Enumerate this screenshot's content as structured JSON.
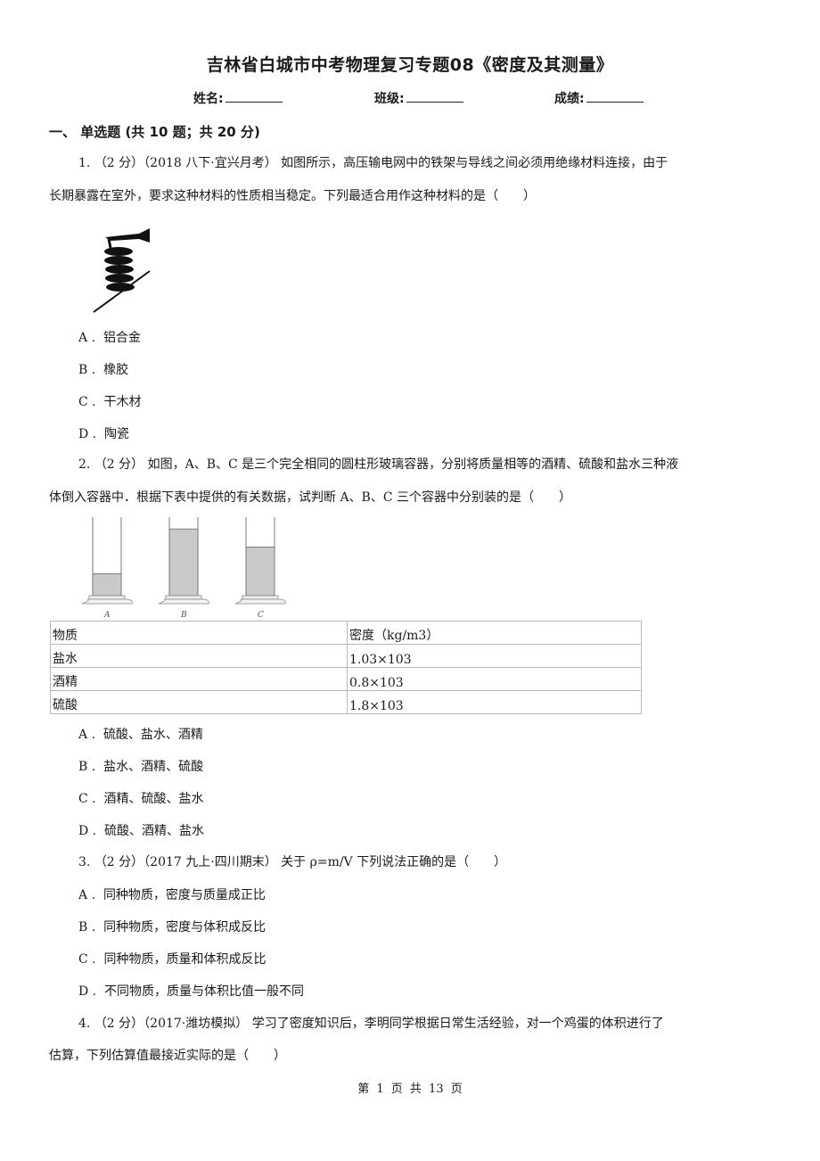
{
  "document": {
    "title": "吉林省白城市中考物理复习专题08《密度及其测量》",
    "fields": [
      {
        "label": "姓名:"
      },
      {
        "label": "班级:"
      },
      {
        "label": "成绩:"
      }
    ],
    "section": {
      "heading": "一、  单选题 (共 10 题；共 20 分)"
    },
    "questions": [
      {
        "number": "1.",
        "score": "（2 分）",
        "source": "（2018 八下·宜兴月考）",
        "text_line1": "如图所示，高压输电网中的铁架与导线之间必须用绝缘材料连接，由于",
        "text_line2": "长期暴露在室外，要求这种材料的性质相当稳定。下列最适合用作这种材料的是（　　）",
        "figure": "insulator-illustration",
        "options": [
          {
            "letter": "A",
            "text": "铝合金"
          },
          {
            "letter": "B",
            "text": "橡胶"
          },
          {
            "letter": "C",
            "text": "干木材"
          },
          {
            "letter": "D",
            "text": "陶瓷"
          }
        ]
      },
      {
        "number": "2.",
        "score": "（2 分）",
        "text_line1": "如图，A、B、C 是三个完全相同的圆柱形玻璃容器，分别将质量相等的酒精、硫酸和盐水三种液",
        "text_line2": "体倒入容器中．根据下表中提供的有关数据，试判断 A、B、C 三个容器中分别装的是（　　）",
        "figure": {
          "containers": [
            {
              "label": "A",
              "fill_level": 0.28
            },
            {
              "label": "B",
              "fill_level": 0.85
            },
            {
              "label": "C",
              "fill_level": 0.62
            }
          ]
        },
        "table": {
          "headers": [
            "物质",
            "密度（kg/m3）"
          ],
          "rows": [
            [
              "盐水",
              "1.03×103"
            ],
            [
              "酒精",
              "0.8×103"
            ],
            [
              "硫酸",
              "1.8×103"
            ]
          ]
        },
        "options": [
          {
            "letter": "A",
            "text": "硫酸、盐水、酒精"
          },
          {
            "letter": "B",
            "text": "盐水、酒精、硫酸"
          },
          {
            "letter": "C",
            "text": "酒精、硫酸、盐水"
          },
          {
            "letter": "D",
            "text": "硫酸、酒精、盐水"
          }
        ]
      },
      {
        "number": "3.",
        "score": "（2 分）",
        "source": "（2017 九上·四川期末）",
        "text_line1": "关于 ρ=m/V 下列说法正确的是（　　）",
        "options": [
          {
            "letter": "A",
            "text": "同种物质，密度与质量成正比"
          },
          {
            "letter": "B",
            "text": "同种物质，密度与体积成反比"
          },
          {
            "letter": "C",
            "text": "同种物质，质量和体积成反比"
          },
          {
            "letter": "D",
            "text": "不同物质，质量与体积比值一般不同"
          }
        ]
      },
      {
        "number": "4.",
        "score": "（2 分）",
        "source": "（2017·潍坊模拟）",
        "text_line1": "学习了密度知识后，李明同学根据日常生活经验，对一个鸡蛋的体积进行了",
        "text_line2": "估算，下列估算值最接近实际的是（　　）"
      }
    ],
    "footer": "第 1 页 共 13 页"
  }
}
